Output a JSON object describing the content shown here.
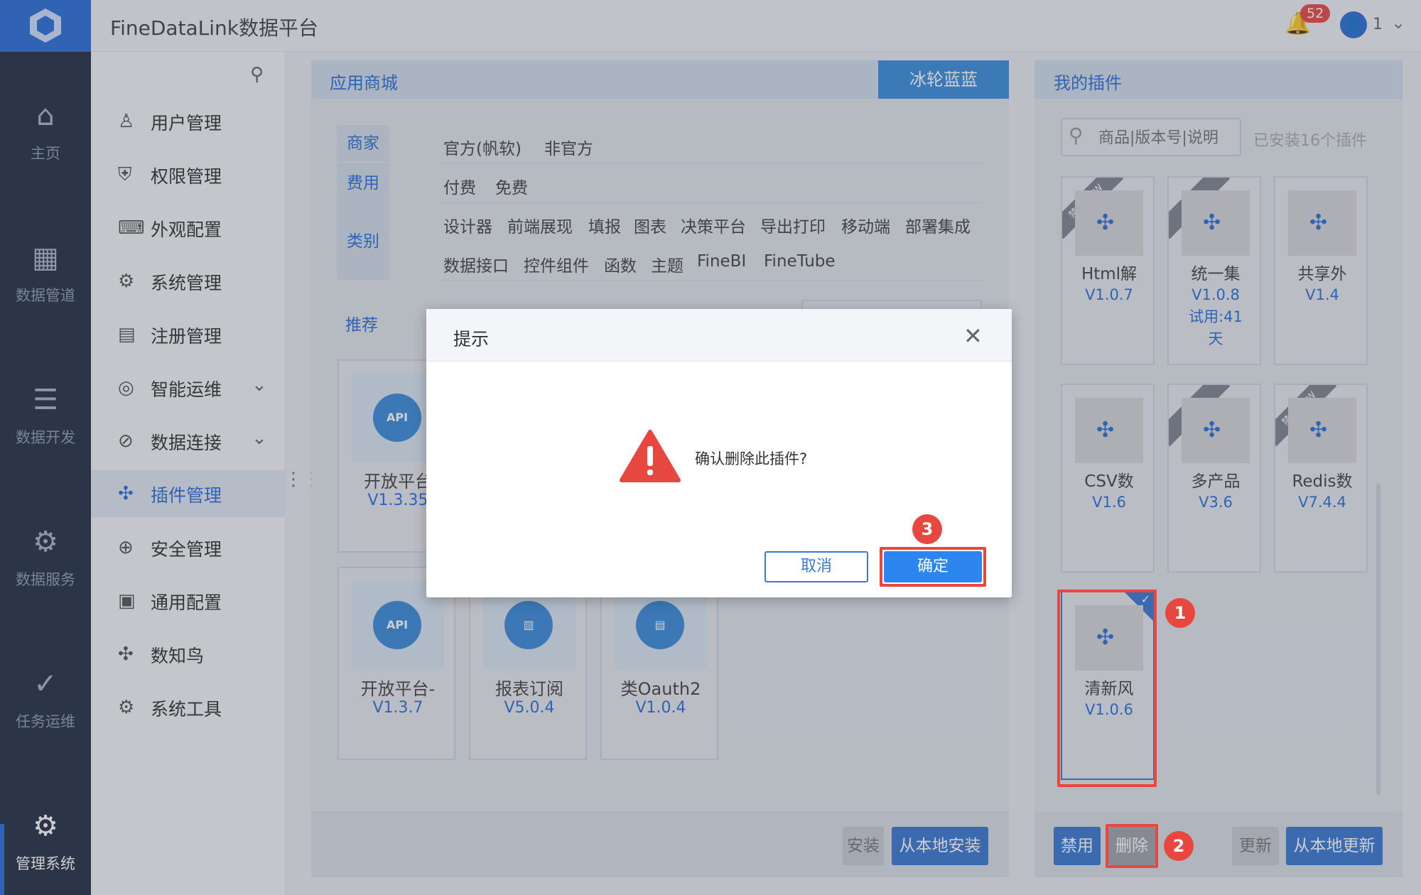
{
  "app": {
    "title": "FineDataLink数据平台",
    "notifications": "52",
    "user_initial": "1"
  },
  "nav": {
    "items": [
      {
        "label": "主页",
        "icon": "home-icon"
      },
      {
        "label": "数据管道",
        "icon": "pipeline-icon"
      },
      {
        "label": "数据开发",
        "icon": "dev-icon"
      },
      {
        "label": "数据服务",
        "icon": "service-icon"
      },
      {
        "label": "任务运维",
        "icon": "task-icon"
      },
      {
        "label": "管理系统",
        "icon": "gear-icon"
      }
    ]
  },
  "sidebar": {
    "items": [
      {
        "label": "用户管理",
        "icon": "user-icon"
      },
      {
        "label": "权限管理",
        "icon": "shield-icon"
      },
      {
        "label": "外观配置",
        "icon": "appearance-icon"
      },
      {
        "label": "系统管理",
        "icon": "gear-icon"
      },
      {
        "label": "注册管理",
        "icon": "register-icon"
      },
      {
        "label": "智能运维",
        "icon": "ops-icon"
      },
      {
        "label": "数据连接",
        "icon": "link-icon"
      },
      {
        "label": "插件管理",
        "icon": "plugin-icon"
      },
      {
        "label": "安全管理",
        "icon": "security-icon"
      },
      {
        "label": "通用配置",
        "icon": "config-icon"
      },
      {
        "label": "数知鸟",
        "icon": "bird-icon"
      },
      {
        "label": "系统工具",
        "icon": "tools-icon"
      }
    ]
  },
  "store": {
    "title": "应用商城",
    "theme": "冰轮蓝蓝",
    "filters": {
      "merchant_label": "商家",
      "merchant": [
        "官方(帆软)",
        "非官方"
      ],
      "fee_label": "费用",
      "fee": [
        "付费",
        "免费"
      ],
      "category_label": "类别",
      "category_row1": [
        "设计器",
        "前端展现",
        "填报",
        "图表",
        "决策平台",
        "导出打印",
        "移动端",
        "部署集成"
      ],
      "category_row2": [
        "数据接口",
        "控件组件",
        "函数",
        "主题",
        "FineBI",
        "FineTube"
      ]
    },
    "recommend_label": "推荐",
    "cards": [
      {
        "name": "开放平台",
        "version": "V1.3.35"
      },
      {
        "name": "开放平台-",
        "version": "V1.3.7"
      },
      {
        "name": "报表订阅",
        "version": "V5.0.4"
      },
      {
        "name": "类Oauth2",
        "version": "V1.0.4"
      }
    ],
    "install": "安装",
    "local_install": "从本地安装"
  },
  "mine": {
    "title": "我的插件",
    "search_placeholder": "商品|版本号|说明",
    "installed_count": "已安装16个插件",
    "plugins": [
      {
        "name": "Html解",
        "version": "V1.0.7"
      },
      {
        "name": "统一集",
        "version": "V1.0.8",
        "extra": "试用:41",
        "extra2": "天"
      },
      {
        "name": "共享外",
        "version": "V1.4"
      },
      {
        "name": "CSV数",
        "version": "V1.6"
      },
      {
        "name": "多产品",
        "version": "V3.6"
      },
      {
        "name": "Redis数",
        "version": "V7.4.4"
      },
      {
        "name": "清新风",
        "version": "V1.0.6"
      }
    ],
    "buttons": {
      "disable": "禁用",
      "delete": "删除",
      "update": "更新",
      "local_update": "从本地更新"
    }
  },
  "dialog": {
    "title": "提示",
    "message": "确认删除此插件?",
    "cancel": "取消",
    "ok": "确定"
  },
  "steps": [
    "1",
    "2",
    "3"
  ]
}
